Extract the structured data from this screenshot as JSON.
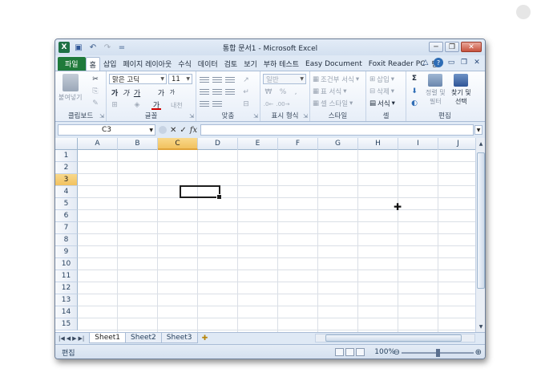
{
  "window": {
    "title": "통합 문서1 - Microsoft Excel",
    "app_letter": "X",
    "minimize": "─",
    "restore": "❐",
    "close": "✕"
  },
  "qat": {
    "save_icon": "💾",
    "undo_icon": "↶",
    "redo_icon": "↷",
    "customize_icon": "="
  },
  "tabs": [
    {
      "label": "파일",
      "kind": "file"
    },
    {
      "label": "홈",
      "kind": "active"
    },
    {
      "label": "삽입",
      "kind": ""
    },
    {
      "label": "페이지 레이아웃",
      "kind": ""
    },
    {
      "label": "수식",
      "kind": ""
    },
    {
      "label": "데이터",
      "kind": ""
    },
    {
      "label": "검토",
      "kind": ""
    },
    {
      "label": "보기",
      "kind": ""
    },
    {
      "label": "부하 테스트",
      "kind": ""
    },
    {
      "label": "Easy Document",
      "kind": ""
    },
    {
      "label": "Foxit Reader PC",
      "kind": ""
    },
    {
      "label": "팀",
      "kind": ""
    }
  ],
  "ribbon": {
    "clipboard": {
      "label": "클립보드",
      "paste": "붙여넣기"
    },
    "font": {
      "label": "글꼴",
      "font_name": "맑은 고딕",
      "font_size": "11",
      "bold": "가",
      "italic": "가",
      "underline": "가",
      "grow": "가",
      "shrink": "가",
      "color_char": "가",
      "phonetic": "내천"
    },
    "alignment": {
      "label": "맞춤"
    },
    "number": {
      "label": "표시 형식",
      "format": "일반",
      "percent": "%",
      "comma": ","
    },
    "styles": {
      "label": "스타일",
      "conditional": "조건부 서식",
      "table": "표 서식",
      "cell_styles": "셀 스타일"
    },
    "cells": {
      "label": "셀",
      "insert": "삽입",
      "delete": "삭제",
      "format": "서식"
    },
    "editing": {
      "label": "편집",
      "sum": "Σ",
      "sort_line1": "정렬 및",
      "sort_line2": "필터",
      "find_line1": "찾기 및",
      "find_line2": "선택"
    }
  },
  "formula_bar": {
    "name_box": "C3",
    "cancel": "✕",
    "enter": "✓",
    "fx": "fx",
    "formula": ""
  },
  "grid": {
    "columns": [
      "A",
      "B",
      "C",
      "D",
      "E",
      "F",
      "G",
      "H",
      "I",
      "J"
    ],
    "rows": [
      "1",
      "2",
      "3",
      "4",
      "5",
      "6",
      "7",
      "8",
      "9",
      "10",
      "11",
      "12",
      "13",
      "14",
      "15"
    ],
    "selected_column": "C",
    "selected_row": "3"
  },
  "sheets": [
    {
      "name": "Sheet1",
      "active": true
    },
    {
      "name": "Sheet2",
      "active": false
    },
    {
      "name": "Sheet3",
      "active": false
    }
  ],
  "status": {
    "mode": "편집",
    "zoom": "100%",
    "zoom_fraction": 0.5
  }
}
